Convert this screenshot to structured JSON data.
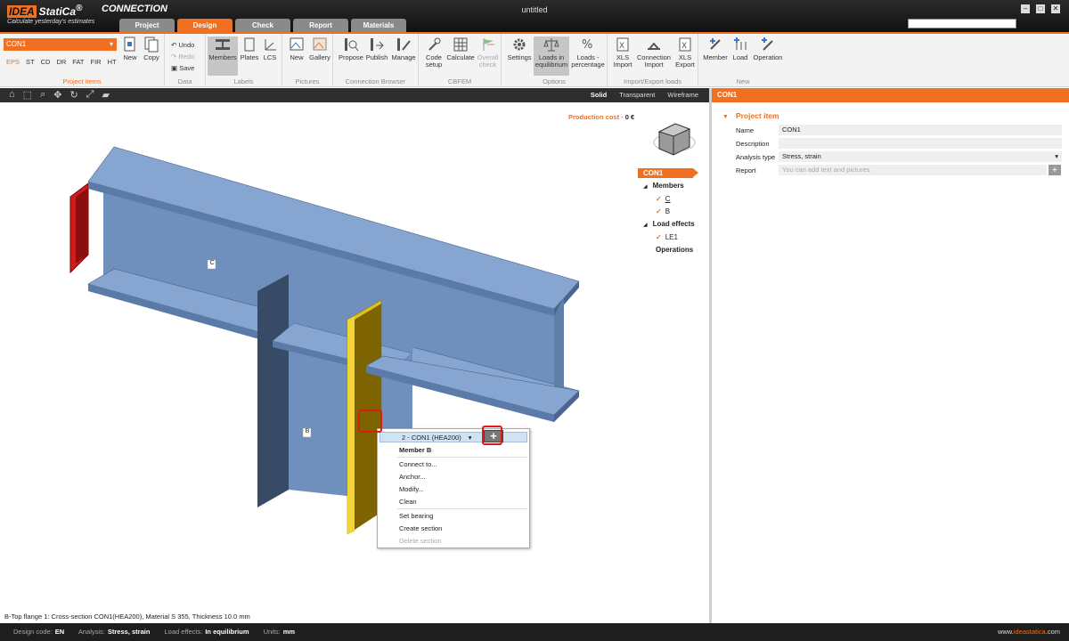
{
  "app": {
    "logo_text": "IDEA",
    "brand": "StatiCa",
    "slogan": "Calculate yesterday's estimates",
    "product": "CONNECTION",
    "window_title": "untitled"
  },
  "tabs": [
    "Project",
    "Design",
    "Check",
    "Report",
    "Materials"
  ],
  "ribbon": {
    "project_items": {
      "selected": "CON1",
      "codes": [
        "EPS",
        "ST",
        "CD",
        "DR",
        "FAT",
        "FIR",
        "HT"
      ],
      "new": "New",
      "copy": "Copy",
      "group": "Project items"
    },
    "data": {
      "undo": "Undo",
      "redo": "Redo",
      "save": "Save",
      "group": "Data"
    },
    "labels": {
      "members": "Members",
      "plates": "Plates",
      "lcs": "LCS",
      "group": "Labels"
    },
    "pictures": {
      "new": "New",
      "gallery": "Gallery",
      "group": "Pictures"
    },
    "browser": {
      "propose": "Propose",
      "publish": "Publish",
      "manage": "Manage",
      "group": "Connection Browser"
    },
    "cbfem": {
      "code_setup": [
        "Code",
        "setup"
      ],
      "calculate": "Calculate",
      "overall": [
        "Overall",
        "check"
      ],
      "group": "CBFEM"
    },
    "options": {
      "settings": "Settings",
      "loads_eq": [
        "Loads in",
        "equilibrium"
      ],
      "loads_pct": [
        "Loads -",
        "percentage"
      ],
      "group": "Options"
    },
    "import_export": {
      "xls_import": [
        "XLS",
        "Import"
      ],
      "conn_import": [
        "Connection",
        "Import"
      ],
      "xls_export": [
        "XLS",
        "Export"
      ],
      "group": "Import/Export loads"
    },
    "new_grp": {
      "member": "Member",
      "load": "Load",
      "operation": "Operation",
      "group": "New"
    }
  },
  "view_modes": [
    "Solid",
    "Transparent",
    "Wireframe"
  ],
  "viewport": {
    "production_cost_label": "Production cost",
    "production_cost_value": "0 €",
    "member_c_label": "C",
    "member_b_label": "B",
    "status_line": "B-Top flange 1: Cross-section CON1(HEA200), Material S 355, Thickness 10.0 mm"
  },
  "tree": {
    "root": "CON1",
    "members_header": "Members",
    "members": [
      "C",
      "B"
    ],
    "load_effects_header": "Load effects",
    "load_effects": [
      "LE1"
    ],
    "operations_header": "Operations"
  },
  "context_menu": {
    "selector": "2 - CON1 (HEA200)",
    "header": "Member B",
    "items1": [
      "Connect to...",
      "Anchor...",
      "Modify...",
      "Clean"
    ],
    "items2": [
      "Set bearing",
      "Create section",
      "Delete section"
    ]
  },
  "right_panel": {
    "header": "CON1",
    "section": "Project item",
    "name_label": "Name",
    "name_value": "CON1",
    "description_label": "Description",
    "analysis_label": "Analysis type",
    "analysis_value": "Stress, strain",
    "report_label": "Report",
    "report_placeholder": "You can add text and pictures"
  },
  "status_bar": {
    "design_code_label": "Design code:",
    "design_code": "EN",
    "analysis_label": "Analysis:",
    "analysis": "Stress, strain",
    "load_effects_label": "Load effects:",
    "load_effects": "In equilibrium",
    "units_label": "Units:",
    "units": "mm",
    "url_prefix": "www.",
    "url_domain": "ideastatica",
    "url_suffix": ".com"
  },
  "colors": {
    "accent": "#f07021",
    "steel": "#7e9cc8",
    "highlight": "#e1c01a",
    "red_member": "#d01c1c"
  }
}
